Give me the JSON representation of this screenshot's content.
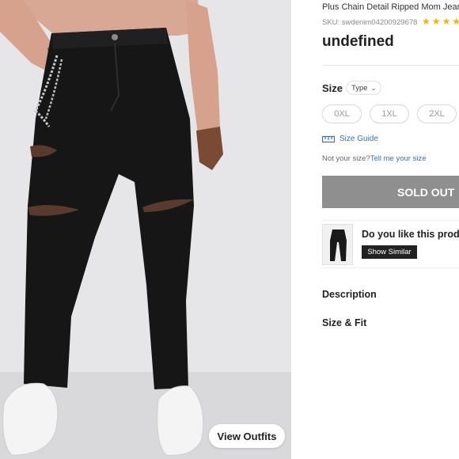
{
  "photo": {
    "alt_subject": "model wearing black ripped mom jeans with chain",
    "view_outfits_label": "View Outfits"
  },
  "product": {
    "title": "Plus Chain Detail Ripped Mom Jean",
    "sku": "SKU: swdenim04200929678",
    "stars": "★★★★",
    "price": "undefined"
  },
  "size": {
    "label": "Size",
    "type_select": "Type",
    "options": [
      "0XL",
      "1XL",
      "2XL"
    ],
    "size_guide": "Size Guide",
    "not_your_size_prefix": "Not your size?",
    "tell_me_link": "Tell me your size"
  },
  "buy": {
    "sold_out_label": "SOLD OUT"
  },
  "similar": {
    "question": "Do you like this prod",
    "button_label": "Show Similar"
  },
  "sections": {
    "description": "Description",
    "size_fit": "Size & Fit"
  },
  "colors": {
    "accent_link": "#3a70b0",
    "star": "#f6b400",
    "sold_out_bg": "#8f8f8f"
  }
}
